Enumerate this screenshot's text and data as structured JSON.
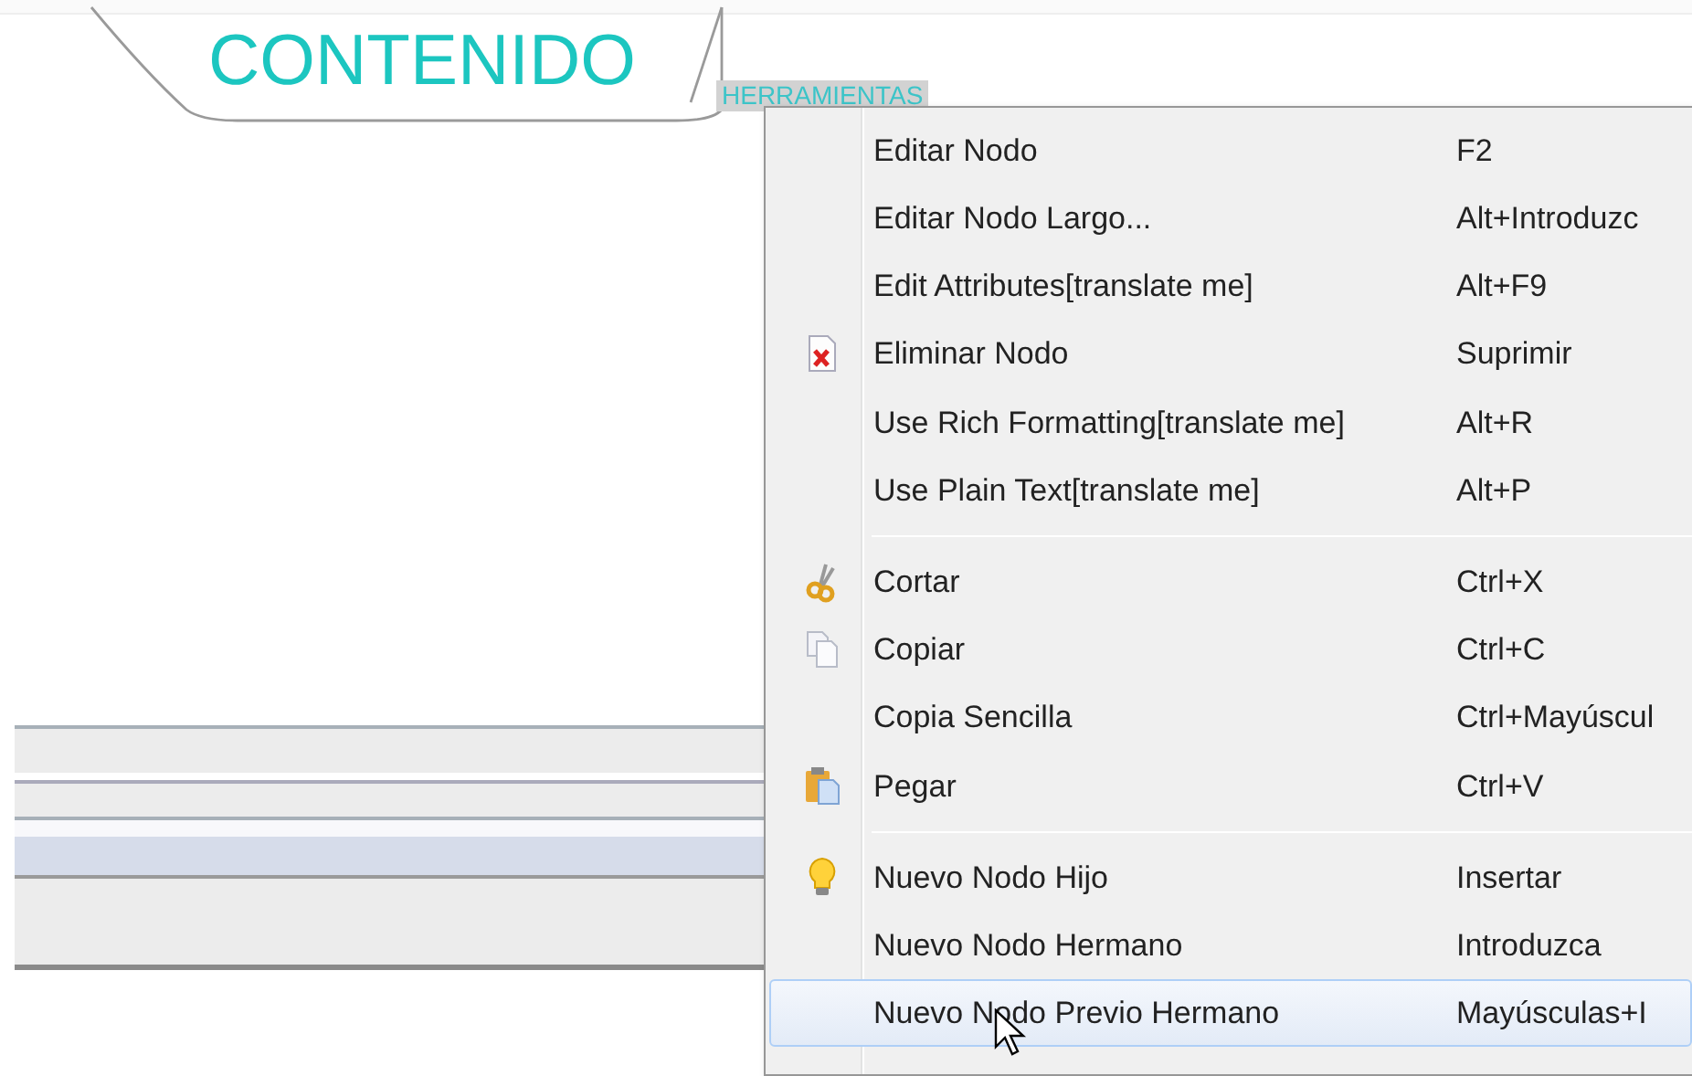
{
  "mind_map": {
    "nodes": [
      {
        "text": "CONTENIDO",
        "kind": "root",
        "selected": false
      },
      {
        "text": "HERRAMIENTAS",
        "kind": "child",
        "selected": true
      }
    ]
  },
  "context_menu": {
    "items": [
      {
        "kind": "plain",
        "label": "Editar Nodo",
        "shortcut": "F2",
        "selected": false
      },
      {
        "kind": "plain",
        "label": "Editar Nodo Largo...",
        "shortcut": "Alt+Introduzc",
        "selected": false
      },
      {
        "kind": "plain",
        "label": "Edit Attributes[translate me]",
        "shortcut": "Alt+F9",
        "selected": false
      },
      {
        "kind": "delete",
        "label": "Eliminar Nodo",
        "shortcut": "Suprimir",
        "selected": false
      },
      {
        "kind": "plain",
        "label": "Use Rich Formatting[translate me]",
        "shortcut": "Alt+R",
        "selected": false
      },
      {
        "kind": "plain",
        "label": "Use Plain Text[translate me]",
        "shortcut": "Alt+P",
        "selected": false
      },
      {
        "kind": "separator"
      },
      {
        "kind": "cut",
        "label": "Cortar",
        "shortcut": "Ctrl+X",
        "selected": false
      },
      {
        "kind": "copy",
        "label": "Copiar",
        "shortcut": "Ctrl+C",
        "selected": false
      },
      {
        "kind": "plain",
        "label": "Copia Sencilla",
        "shortcut": "Ctrl+Mayúscul",
        "selected": false
      },
      {
        "kind": "paste",
        "label": "Pegar",
        "shortcut": "Ctrl+V",
        "selected": false
      },
      {
        "kind": "separator"
      },
      {
        "kind": "idea",
        "label": "Nuevo Nodo Hijo",
        "shortcut": "Insertar",
        "selected": false
      },
      {
        "kind": "plain",
        "label": "Nuevo Nodo Hermano",
        "shortcut": "Introduzca",
        "selected": false
      },
      {
        "kind": "plain",
        "label": "Nuevo Nodo Previo Hermano",
        "shortcut": "Mayúsculas+I",
        "selected": true
      }
    ]
  }
}
